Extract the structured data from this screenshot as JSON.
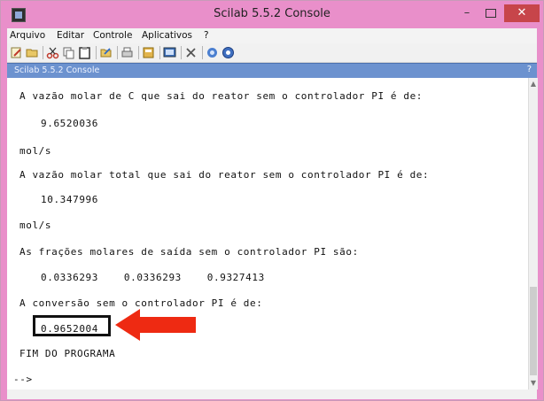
{
  "window": {
    "title": "Scilab 5.5.2 Console",
    "minimize_glyph": "–",
    "close_glyph": "✕"
  },
  "menubar": {
    "items": [
      "Arquivo",
      "Editar",
      "Controle",
      "Aplicativos",
      "?"
    ]
  },
  "toolbar": {
    "icons": [
      "new-script-icon",
      "open-folder-icon",
      "cut-icon",
      "copy-icon",
      "paste-icon",
      "change-directory-icon",
      "print-icon",
      "variable-browser-icon",
      "console-icon",
      "module-manager-icon",
      "demos-icon",
      "help-icon"
    ]
  },
  "console": {
    "tab_label": "Scilab 5.5.2 Console",
    "lines": [
      "A vazão molar de C que sai do reator sem o controlador PI é de:",
      "9.6520036",
      "mol/s",
      "A vazão molar total que sai do reator sem o controlador PI é de:",
      "10.347996",
      "mol/s",
      "As frações molares de saída sem o controlador PI são:",
      "0.0336293    0.0336293    0.9327413",
      "A conversão sem o controlador PI é de:",
      "0.9652004",
      "FIM DO PROGRAMA",
      "-->"
    ]
  },
  "colors": {
    "title_bar": "#e98fca",
    "close_button": "#c7454a",
    "tab_header": "#6c92cf",
    "highlight_border": "#111111",
    "arrow": "#ee2a12"
  }
}
